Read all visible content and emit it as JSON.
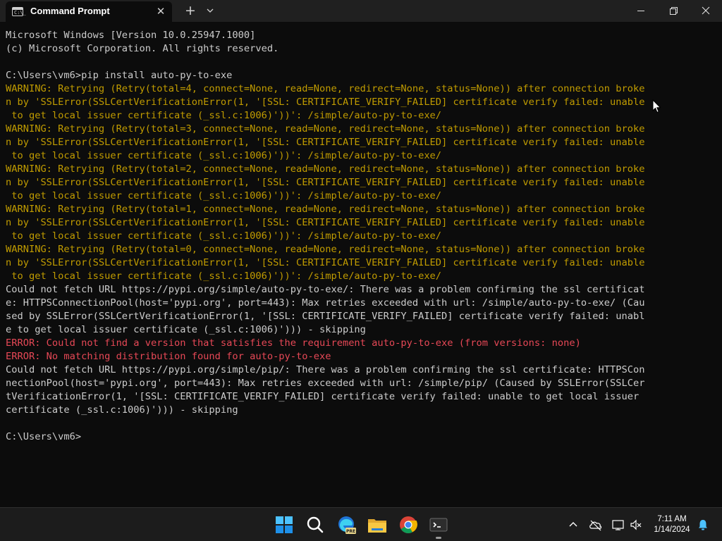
{
  "window": {
    "tab_title": "Command Prompt",
    "tab_icon_text": "C:\\_"
  },
  "terminal": {
    "lines": [
      {
        "text": "Microsoft Windows [Version 10.0.25947.1000]",
        "type": "normal"
      },
      {
        "text": "(c) Microsoft Corporation. All rights reserved.",
        "type": "normal"
      },
      {
        "text": "",
        "type": "normal"
      },
      {
        "text": "C:\\Users\\vm6>pip install auto-py-to-exe",
        "type": "normal"
      },
      {
        "text": "WARNING: Retrying (Retry(total=4, connect=None, read=None, redirect=None, status=None)) after connection broke",
        "type": "warn"
      },
      {
        "text": "n by 'SSLError(SSLCertVerificationError(1, '[SSL: CERTIFICATE_VERIFY_FAILED] certificate verify failed: unable",
        "type": "warn"
      },
      {
        "text": " to get local issuer certificate (_ssl.c:1006)'))': /simple/auto-py-to-exe/",
        "type": "warn"
      },
      {
        "text": "WARNING: Retrying (Retry(total=3, connect=None, read=None, redirect=None, status=None)) after connection broke",
        "type": "warn"
      },
      {
        "text": "n by 'SSLError(SSLCertVerificationError(1, '[SSL: CERTIFICATE_VERIFY_FAILED] certificate verify failed: unable",
        "type": "warn"
      },
      {
        "text": " to get local issuer certificate (_ssl.c:1006)'))': /simple/auto-py-to-exe/",
        "type": "warn"
      },
      {
        "text": "WARNING: Retrying (Retry(total=2, connect=None, read=None, redirect=None, status=None)) after connection broke",
        "type": "warn"
      },
      {
        "text": "n by 'SSLError(SSLCertVerificationError(1, '[SSL: CERTIFICATE_VERIFY_FAILED] certificate verify failed: unable",
        "type": "warn"
      },
      {
        "text": " to get local issuer certificate (_ssl.c:1006)'))': /simple/auto-py-to-exe/",
        "type": "warn"
      },
      {
        "text": "WARNING: Retrying (Retry(total=1, connect=None, read=None, redirect=None, status=None)) after connection broke",
        "type": "warn"
      },
      {
        "text": "n by 'SSLError(SSLCertVerificationError(1, '[SSL: CERTIFICATE_VERIFY_FAILED] certificate verify failed: unable",
        "type": "warn"
      },
      {
        "text": " to get local issuer certificate (_ssl.c:1006)'))': /simple/auto-py-to-exe/",
        "type": "warn"
      },
      {
        "text": "WARNING: Retrying (Retry(total=0, connect=None, read=None, redirect=None, status=None)) after connection broke",
        "type": "warn"
      },
      {
        "text": "n by 'SSLError(SSLCertVerificationError(1, '[SSL: CERTIFICATE_VERIFY_FAILED] certificate verify failed: unable",
        "type": "warn"
      },
      {
        "text": " to get local issuer certificate (_ssl.c:1006)'))': /simple/auto-py-to-exe/",
        "type": "warn"
      },
      {
        "text": "Could not fetch URL https://pypi.org/simple/auto-py-to-exe/: There was a problem confirming the ssl certificat",
        "type": "normal"
      },
      {
        "text": "e: HTTPSConnectionPool(host='pypi.org', port=443): Max retries exceeded with url: /simple/auto-py-to-exe/ (Cau",
        "type": "normal"
      },
      {
        "text": "sed by SSLError(SSLCertVerificationError(1, '[SSL: CERTIFICATE_VERIFY_FAILED] certificate verify failed: unabl",
        "type": "normal"
      },
      {
        "text": "e to get local issuer certificate (_ssl.c:1006)'))) - skipping",
        "type": "normal"
      },
      {
        "text": "ERROR: Could not find a version that satisfies the requirement auto-py-to-exe (from versions: none)",
        "type": "err"
      },
      {
        "text": "ERROR: No matching distribution found for auto-py-to-exe",
        "type": "err"
      },
      {
        "text": "Could not fetch URL https://pypi.org/simple/pip/: There was a problem confirming the ssl certificate: HTTPSCon",
        "type": "normal"
      },
      {
        "text": "nectionPool(host='pypi.org', port=443): Max retries exceeded with url: /simple/pip/ (Caused by SSLError(SSLCer",
        "type": "normal"
      },
      {
        "text": "tVerificationError(1, '[SSL: CERTIFICATE_VERIFY_FAILED] certificate verify failed: unable to get local issuer",
        "type": "normal"
      },
      {
        "text": "certificate (_ssl.c:1006)'))) - skipping",
        "type": "normal"
      },
      {
        "text": "",
        "type": "normal"
      },
      {
        "text": "C:\\Users\\vm6>",
        "type": "normal"
      }
    ]
  },
  "taskbar": {
    "apps": [
      "start-icon",
      "search-icon",
      "edge-beta-icon",
      "file-explorer-icon",
      "chrome-icon",
      "terminal-icon"
    ],
    "edge_badge": "PRE",
    "time": "7:11 AM",
    "date": "1/14/2024"
  },
  "colors": {
    "background": "#0c0c0c",
    "text": "#cccccc",
    "warning": "#c19c00",
    "error": "#e74856",
    "titlebar": "#202020",
    "taskbar": "#1c1c1c"
  }
}
